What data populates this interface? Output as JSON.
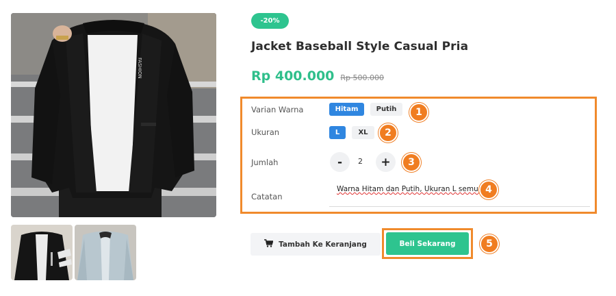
{
  "product": {
    "discount_badge": "-20%",
    "title": "Jacket Baseball Style Casual Pria",
    "price": "Rp 400.000",
    "old_price": "Rp 500.000",
    "jacket_print": "FASHION"
  },
  "options": {
    "color_label": "Varian Warna",
    "colors": [
      {
        "label": "Hitam",
        "selected": true
      },
      {
        "label": "Putih",
        "selected": false
      }
    ],
    "size_label": "Ukuran",
    "sizes": [
      {
        "label": "L",
        "selected": true
      },
      {
        "label": "XL",
        "selected": false
      }
    ],
    "quantity_label": "Jumlah",
    "quantity": {
      "minus": "-",
      "value": "2",
      "plus": "+"
    },
    "notes_label": "Catatan",
    "notes_value": "Warna Hitam dan Putih, Ukuran L semua."
  },
  "markers": [
    "1",
    "2",
    "3",
    "4",
    "5"
  ],
  "actions": {
    "add_to_cart": "Tambah Ke Keranjang",
    "buy_now": "Beli Sekarang"
  },
  "colors": {
    "accent_green": "#2ec48f",
    "selected_blue": "#2f86e0",
    "highlight_orange": "#f08a2c"
  },
  "icons": {
    "cart": "shopping-cart-icon"
  }
}
